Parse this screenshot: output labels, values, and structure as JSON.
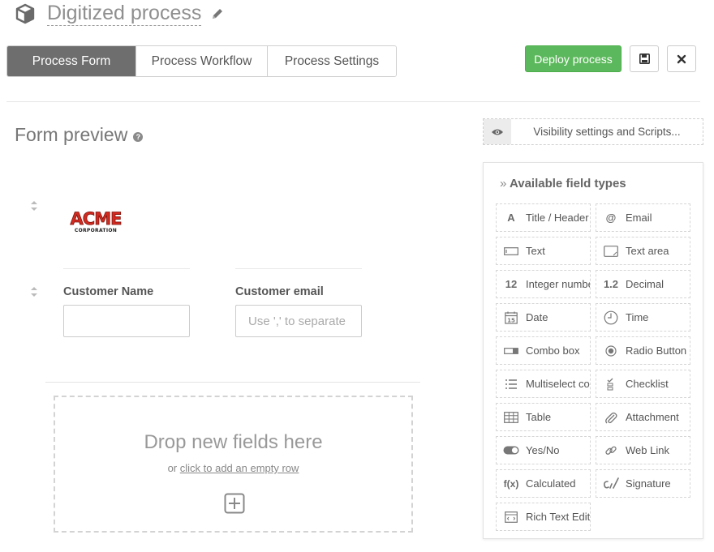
{
  "header": {
    "title": "Digitized process"
  },
  "tabs": [
    "Process Form",
    "Process Workflow",
    "Process Settings"
  ],
  "toolbar": {
    "deploy_label": "Deploy process"
  },
  "form_preview": {
    "title": "Form preview",
    "help": "?"
  },
  "fields": {
    "customer_name_label": "Customer Name",
    "customer_email_label": "Customer email",
    "customer_email_placeholder": "Use ',' to separate multiple emails"
  },
  "dropzone": {
    "title": "Drop new fields here",
    "or": "or",
    "link": "click to add an empty row"
  },
  "visibility": {
    "label": "Visibility settings and Scripts..."
  },
  "field_panel": {
    "title": "Available field types",
    "items": [
      {
        "label": "Title / Header",
        "icon": "title-header-icon",
        "glyph": "A"
      },
      {
        "label": "Email",
        "icon": "at-icon",
        "glyph": "@"
      },
      {
        "label": "Text",
        "icon": "text-field-icon"
      },
      {
        "label": "Text area",
        "icon": "text-area-icon"
      },
      {
        "label": "Integer number",
        "icon": "integer-icon",
        "glyph": "12"
      },
      {
        "label": "Decimal",
        "icon": "decimal-icon",
        "glyph": "1.2"
      },
      {
        "label": "Date",
        "icon": "calendar-icon",
        "glyph": "15"
      },
      {
        "label": "Time",
        "icon": "clock-icon"
      },
      {
        "label": "Combo box",
        "icon": "combo-box-icon"
      },
      {
        "label": "Radio Button",
        "icon": "radio-button-icon"
      },
      {
        "label": "Multiselect combo",
        "icon": "list-icon"
      },
      {
        "label": "Checklist",
        "icon": "checklist-icon"
      },
      {
        "label": "Table",
        "icon": "table-icon"
      },
      {
        "label": "Attachment",
        "icon": "paperclip-icon"
      },
      {
        "label": "Yes/No",
        "icon": "toggle-icon"
      },
      {
        "label": "Web Link",
        "icon": "link-icon"
      },
      {
        "label": "Calculated",
        "icon": "function-icon",
        "glyph": "f(x)"
      },
      {
        "label": "Signature",
        "icon": "signature-icon"
      },
      {
        "label": "Rich Text Editor",
        "icon": "rich-text-icon"
      }
    ]
  },
  "logo": {
    "text": "ACME",
    "subtext": "CORPORATION"
  },
  "colors": {
    "accent_green": "#5cb85c",
    "active_tab": "#6e6e6e",
    "logo_red": "#d42a1f"
  }
}
